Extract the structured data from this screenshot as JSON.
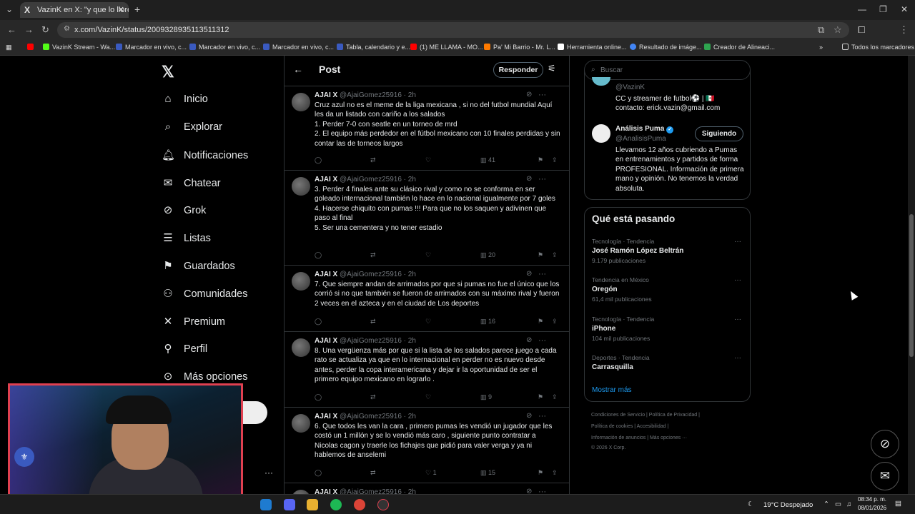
{
  "browser": {
    "tab_title": "VazinK en X: \"y que lo lloren los...",
    "url": "x.com/VazinK/status/2009328935113511312",
    "bookmarks": [
      {
        "label": "",
        "color": "#ff0000"
      },
      {
        "label": "VazinK Stream - Wa...",
        "color": "#53fc18"
      },
      {
        "label": "Marcador en vivo, c...",
        "color": "#3a5ac0"
      },
      {
        "label": "Marcador en vivo, c...",
        "color": "#3a5ac0"
      },
      {
        "label": "Marcador en vivo, c...",
        "color": "#3a5ac0"
      },
      {
        "label": "Tabla, calendario y e...",
        "color": "#3a5ac0"
      },
      {
        "label": "(1) ME LLAMA - MO...",
        "color": "#ff0000"
      },
      {
        "label": "Pa' Mi Barrio - Mr. L...",
        "color": "#ff7a00"
      },
      {
        "label": "Herramienta online...",
        "color": "#ffffff"
      },
      {
        "label": "Resultado de imáge...",
        "color": "#4285f4"
      },
      {
        "label": "Creador de Alineaci...",
        "color": "#2ea44f"
      }
    ],
    "all_bookmarks": "Todos los marcadores"
  },
  "sidebar": {
    "items": [
      {
        "label": "Inicio",
        "icon": "home-icon"
      },
      {
        "label": "Explorar",
        "icon": "search-icon"
      },
      {
        "label": "Notificaciones",
        "icon": "bell-icon"
      },
      {
        "label": "Chatear",
        "icon": "mail-icon"
      },
      {
        "label": "Grok",
        "icon": "grok-icon"
      },
      {
        "label": "Listas",
        "icon": "list-icon"
      },
      {
        "label": "Guardados",
        "icon": "bookmark-icon"
      },
      {
        "label": "Comunidades",
        "icon": "communities-icon"
      },
      {
        "label": "Premium",
        "icon": "x-icon"
      },
      {
        "label": "Perfil",
        "icon": "person-icon"
      },
      {
        "label": "Más opciones",
        "icon": "more-icon"
      }
    ]
  },
  "header": {
    "title": "Post",
    "reply_button": "Responder"
  },
  "tweets": [
    {
      "name": "AJAI X",
      "handle": "@AjaiGomez25916 · 2h",
      "text": "Cruz azul no es el meme de la liga mexicana , si no del futbol mundial Aquí les da un listado con cariño a los salados\n1. Perder 7-0 con seatle en un torneo de mrd\n2. El equipo más perdedor en el fútbol mexicano con 10 finales perdidas y sin contar las de torneos largos",
      "likes": "",
      "views": "41"
    },
    {
      "name": "AJAI X",
      "handle": "@AjaiGomez25916 · 2h",
      "text": "3. Perder 4 finales ante su clásico rival y como no se conforma en ser goleado internacional también lo hace en lo nacional igualmente por 7 goles\n4. Hacerse chiquito con pumas !!! Para que no los saquen y adivinen que paso al final\n5. Ser una cementera y no tener estadio",
      "likes": "",
      "views": "20"
    },
    {
      "name": "AJAI X",
      "handle": "@AjaiGomez25916 · 2h",
      "text": "7. Que siempre andan de arrimados por que si pumas no fue el único que los corrió si no que también se fueron de arrimados con su máximo rival y fueron 2 veces en el azteca y en el ciudad de Los deportes",
      "likes": "",
      "views": "16"
    },
    {
      "name": "AJAI X",
      "handle": "@AjaiGomez25916 · 2h",
      "text": "8. Una vergüenza más por que si la lista de los salados parece juego a cada rato se actualiza ya que en lo internacional en perder no es nuevo desde antes,  perder la copa interamericana y dejar ir la oportunidad de ser el primero equipo mexicano en lograrlo .",
      "likes": "",
      "views": "9"
    },
    {
      "name": "AJAI X",
      "handle": "@AjaiGomez25916 · 2h",
      "text": "6. Que todos les van la cara , primero pumas les vendió un jugador que les costó un 1 millón y se lo  vendió más caro , siguiente punto contratar a Nicolas cagon y traerle los fichajes que pidió para valer verga y ya ni hablemos de anselemi",
      "likes": "1",
      "views": "15"
    },
    {
      "name": "AJAI X",
      "handle": "@AjaiGomez25916 · 2h",
      "text": "",
      "likes": "",
      "views": ""
    }
  ],
  "right": {
    "search_placeholder": "Buscar",
    "who1": {
      "handle": "@VazinK",
      "bio": "CC y streamer de futbol⚽ | 🇲🇽\ncontacto: erick.vazin@gmail.com"
    },
    "who2": {
      "name": "Análisis Puma",
      "handle": "@AnalisisPuma",
      "button": "Siguiendo",
      "bio": "Llevamos 12 años cubriendo a Pumas en entrenamientos y partidos de forma PROFESIONAL. Información de primera mano y opinión. No tenemos la verdad absoluta."
    },
    "trends_title": "Qué está pasando",
    "trends": [
      {
        "category": "Tecnología · Tendencia",
        "name": "José Ramón López Beltrán",
        "count": "9.179 publicaciones"
      },
      {
        "category": "Tendencia en México",
        "name": "Oregón",
        "count": "61,4 mil publicaciones"
      },
      {
        "category": "Tecnología · Tendencia",
        "name": "iPhone",
        "count": "104 mil publicaciones"
      },
      {
        "category": "Deportes · Tendencia",
        "name": "Carrasquilla",
        "count": ""
      }
    ],
    "show_more": "Mostrar más",
    "footer": {
      "line1": "Condiciones de Servicio  |  Política de Privacidad  |",
      "line2": "Política de cookies  |  Accesibilidad  |",
      "line3": "Información de anuncios  |  Más opciones ···",
      "line4": "© 2026 X Corp."
    }
  },
  "taskbar": {
    "weather": "19°C  Despejado",
    "time": "08:34 p. m.",
    "date": "08/01/2026"
  }
}
